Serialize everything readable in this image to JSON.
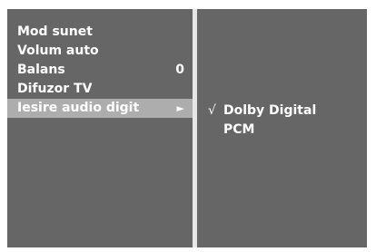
{
  "audio_menu": {
    "items": [
      {
        "label": "Mod sunet",
        "value": ""
      },
      {
        "label": "Volum auto",
        "value": ""
      },
      {
        "label": "Balans",
        "value": "0"
      },
      {
        "label": "Difuzor TV",
        "value": ""
      },
      {
        "label": "Iesire audio digit",
        "value": "",
        "selected": true,
        "submenu_arrow": "►"
      }
    ]
  },
  "submenu": {
    "options": [
      {
        "label": "Dolby Digital",
        "checked": true,
        "check_mark": "√"
      },
      {
        "label": "PCM",
        "checked": false,
        "check_mark": ""
      }
    ]
  },
  "colors": {
    "panel_bg": "#666666",
    "selection_bg": "#adadad",
    "divider": "#e6e6e6",
    "text": "#ffffff"
  }
}
